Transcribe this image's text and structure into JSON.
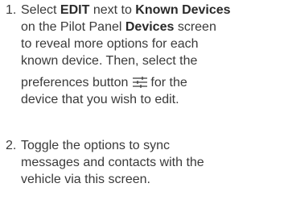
{
  "steps": [
    {
      "number": "1.",
      "line1_pre": "Select ",
      "line1_b1": "EDIT",
      "line1_mid": " next to ",
      "line1_b2": "Known Devices",
      "line2_pre": "on the Pilot Panel ",
      "line2_b1": "Devices",
      "line2_post": " screen",
      "line3": "to reveal more options for each",
      "line4": "known device. Then, select the",
      "line5_pre": "preferences button",
      "line5_post": "for the",
      "line6": "device that you wish to edit.",
      "icon": "preferences-sliders-icon"
    },
    {
      "number": "2.",
      "line1": "Toggle the options to sync",
      "line2": "messages and contacts with the",
      "line3": "vehicle via this screen."
    }
  ]
}
